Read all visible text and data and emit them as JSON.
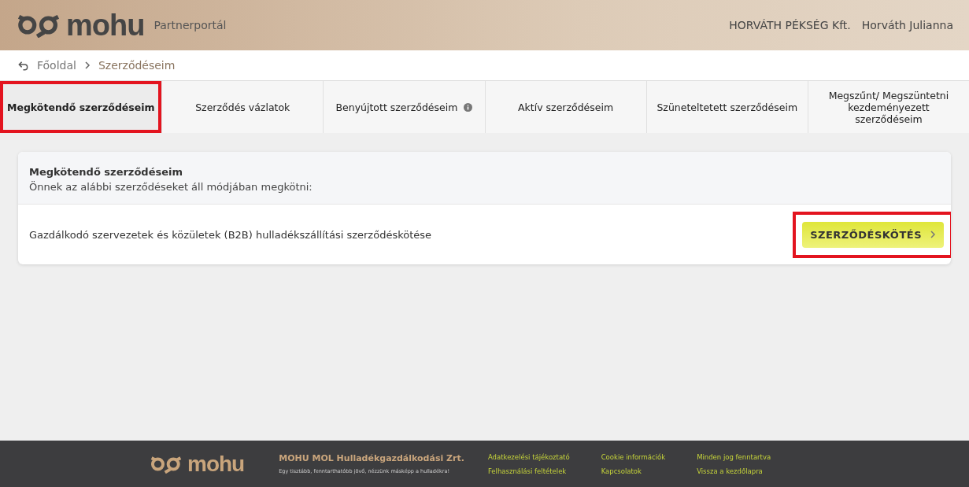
{
  "header": {
    "logo_text": "mohu",
    "portal": "Partnerportál",
    "company": "HORVÁTH PÉKSÉG Kft.",
    "user": "Horváth Julianna"
  },
  "breadcrumb": [
    {
      "label": "Főoldal",
      "current": false
    },
    {
      "label": "Szerződéseim",
      "current": true
    }
  ],
  "tabs": [
    {
      "label": "Megkötendő szerződéseim",
      "selected": true,
      "highlighted": true,
      "info": false
    },
    {
      "label": "Szerződés vázlatok",
      "selected": false,
      "highlighted": false,
      "info": false
    },
    {
      "label": "Benyújtott szerződéseim",
      "selected": false,
      "highlighted": false,
      "info": true
    },
    {
      "label": "Aktív szerződéseim",
      "selected": false,
      "highlighted": false,
      "info": false
    },
    {
      "label": "Szüneteltetett szerződéseim",
      "selected": false,
      "highlighted": false,
      "info": false
    },
    {
      "label": "Megszűnt/ Megszüntetni kezdeményezett szerződéseim",
      "selected": false,
      "highlighted": false,
      "info": false
    }
  ],
  "panel": {
    "title": "Megkötendő szerződéseim",
    "subtitle": "Önnek az alábbi szerződéseket áll módjában megkötni:",
    "contracts": [
      {
        "name": "Gazdálkodó szervezetek és közületek (B2B) hulladékszállítási szerződéskötése",
        "button": "SZERZŐDÉSKÖTÉS",
        "highlighted": true
      }
    ]
  },
  "footer": {
    "logo_text": "mohu",
    "company": "MOHU MOL Hulladékgazdálkodási Zrt.",
    "tagline": "Egy tisztább, fenntarthatóbb jövő, nézzünk másképp a hulladékra!",
    "links": [
      [
        "Adatkezelési tájékoztató",
        "Felhasználási feltételek"
      ],
      [
        "Cookie információk",
        "Kapcsolatok"
      ],
      [
        "Minden jog fenntartva",
        "Vissza a kezdőlapra"
      ]
    ]
  }
}
